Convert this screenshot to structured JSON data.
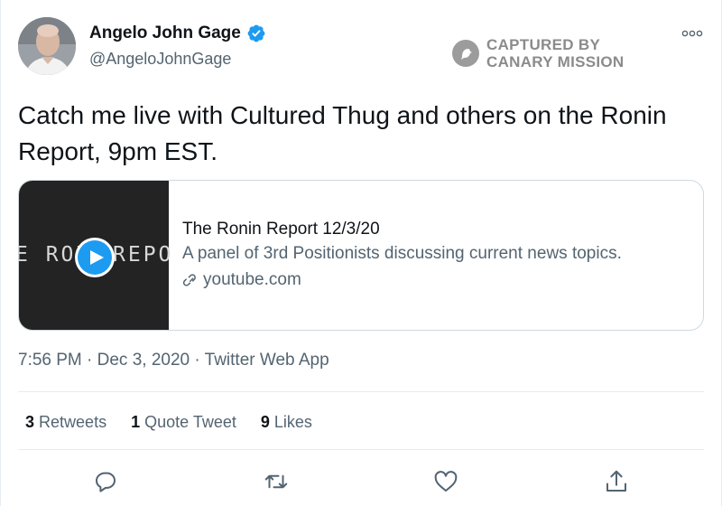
{
  "author": {
    "display_name": "Angelo John Gage",
    "handle": "@AngeloJohnGage",
    "verified": true
  },
  "watermark": {
    "line1": "CAPTURED BY",
    "line2": "CANARY MISSION",
    "icon": "canary-bird-icon"
  },
  "tweet": {
    "text": "Catch me live with Cultured Thug and others on the Ronin Report, 9pm EST.",
    "timestamp": "7:56 PM · Dec 3, 2020 · Twitter Web App"
  },
  "card": {
    "thumbnail_left_text": "E RON",
    "thumbnail_right_text": "REPO",
    "title": "The Ronin Report 12/3/20",
    "description": "A panel of 3rd Positionists discussing current news topics.",
    "domain": "youtube.com"
  },
  "stats": {
    "retweets_count": "3",
    "retweets_label": "Retweets",
    "quotes_count": "1",
    "quotes_label": "Quote Tweet",
    "likes_count": "9",
    "likes_label": "Likes"
  },
  "colors": {
    "accent": "#1d9bf0",
    "text_primary": "#0f1419",
    "text_secondary": "#536471",
    "border": "#cfd9de"
  },
  "actions": [
    "reply-icon",
    "retweet-icon",
    "like-icon",
    "share-icon"
  ]
}
